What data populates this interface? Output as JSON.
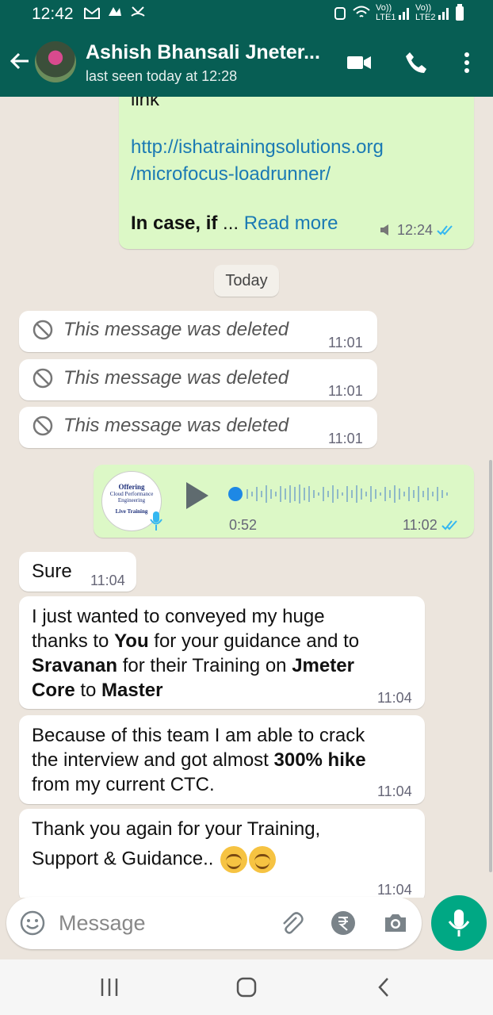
{
  "status_bar": {
    "time": "12:42",
    "net1": "Vo)) LTE1",
    "net2": "Vo)) LTE2"
  },
  "header": {
    "contact_name": "Ashish Bhansali Jneter...",
    "last_seen": "last seen today at 12:28"
  },
  "colors": {
    "header": "#075e54",
    "outgoing": "#dcf8c6",
    "incoming": "#ffffff",
    "accent": "#00a884",
    "link": "#1b7ab4",
    "read_tick": "#34b7f1"
  },
  "messages": {
    "m0": {
      "top_text": "link",
      "link1": "http://ishatrainingsolutions.org",
      "link2": "/microfocus-loadrunner/",
      "bold_text": "In case, if",
      "ellipsis": " ... ",
      "read_more": "Read more",
      "time": "12:24"
    },
    "date_chip": "Today",
    "deleted_text": "This message was deleted",
    "d1_time": "11:01",
    "d2_time": "11:01",
    "d3_time": "11:01",
    "voice": {
      "duration": "0:52",
      "time": "11:02",
      "thumb_lines": [
        "Offering",
        "Cloud Performance",
        "Engineering",
        "Live Training"
      ]
    },
    "sure": {
      "text": "Sure",
      "time": "11:04"
    },
    "thanks": {
      "l1": "I just wanted to conveyed my huge",
      "l2a": "thanks to ",
      "l2b": "You",
      "l2c": " for your guidance and to",
      "l3a": "Sravanan",
      "l3b": " for their Training on ",
      "l3c": "Jmeter",
      "l4a": "Core",
      "l4b": " to ",
      "l4c": "Master",
      "time": "11:04"
    },
    "because": {
      "l1": "Because of this team I am able to crack",
      "l2a": "the interview and got almost ",
      "l2b": "300% hike",
      "l3": "from my current CTC.",
      "time": "11:04"
    },
    "thankyou": {
      "l1": "Thank you again for your Training,",
      "l2": "Support & Guidance..",
      "time": "11:04"
    }
  },
  "composer": {
    "placeholder": "Message"
  }
}
